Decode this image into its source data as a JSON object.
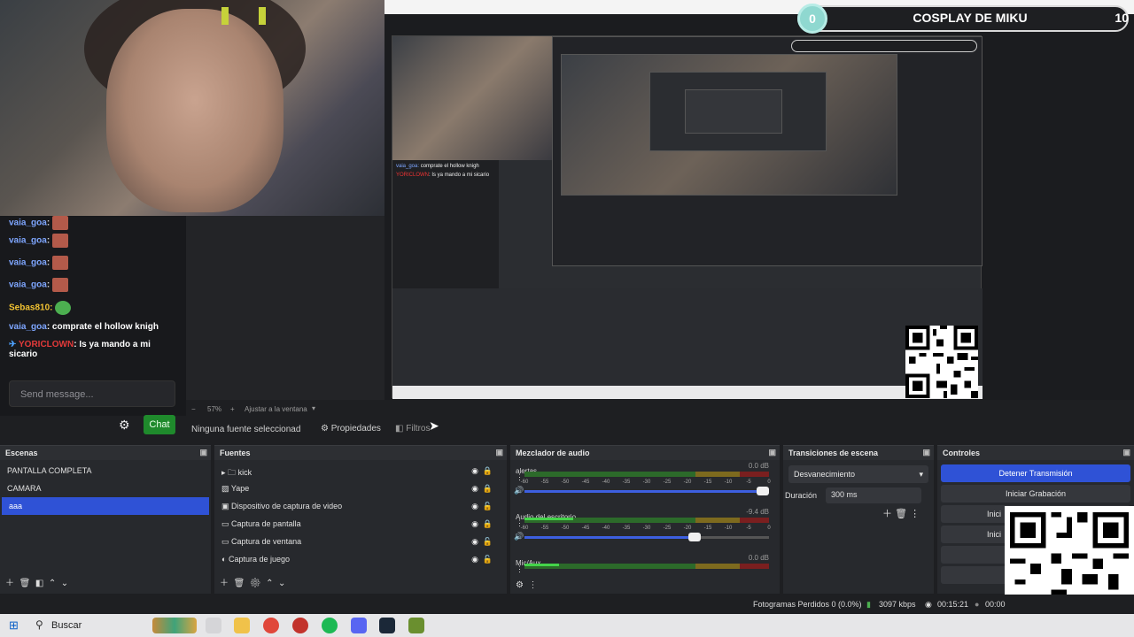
{
  "overlay": {
    "goal_current": "0",
    "goal_title": "COSPLAY DE MIKU",
    "goal_target": "10"
  },
  "chat": {
    "messages": [
      {
        "user": "vaia_goa",
        "text": ""
      },
      {
        "user": "vaia_goa",
        "text": ""
      },
      {
        "user": "vaia_goa",
        "text": ""
      },
      {
        "user": "vaia_goa",
        "text": ""
      },
      {
        "user": "Sebas810:",
        "text": ""
      },
      {
        "user": "vaia_goa",
        "text": ": comprate el hollow knigh"
      },
      {
        "user": "YORICLOWN",
        "text": ": Is ya mando a mi sicario"
      }
    ],
    "send_placeholder": "Send message...",
    "chat_button": "Chat"
  },
  "preview_bar": {
    "zoom": "57%",
    "fit": "Ajustar a la ventana"
  },
  "source_toolbar": {
    "no_source": "Ninguna fuente seleccionad",
    "properties": "Propiedades",
    "filters": "Filtros"
  },
  "scenes": {
    "title": "Escenas",
    "items": [
      "PANTALLA COMPLETA",
      "CAMARA",
      "aaa"
    ]
  },
  "sources": {
    "title": "Fuentes",
    "items": [
      "kick",
      "Yape",
      "Dispositivo de captura de video",
      "Captura de pantalla",
      "Captura de ventana",
      "Captura de juego"
    ]
  },
  "mixer": {
    "title": "Mezclador de audio",
    "channels": [
      {
        "name": "alertas",
        "db": "0.0 dB",
        "level": 0.0
      },
      {
        "name": "Audio del escritorio",
        "db": "-9.4 dB",
        "level": 0.2
      },
      {
        "name": "Mic/Aux",
        "db": "0.0 dB",
        "level": 0.14
      }
    ],
    "ticks": [
      "-60",
      "-55",
      "-50",
      "-45",
      "-40",
      "-35",
      "-30",
      "-25",
      "-20",
      "-15",
      "-10",
      "-5",
      "0"
    ]
  },
  "transitions": {
    "title": "Transiciones de escena",
    "selected": "Desvanecimiento",
    "duration_label": "Duración",
    "duration_value": "300 ms"
  },
  "controls": {
    "title": "Controles",
    "stop_stream": "Detener Transmisión",
    "start_record": "Iniciar Grabación",
    "btn3": "Inici",
    "btn4": "Inici"
  },
  "status": {
    "dropped": "Fotogramas Perdidos 0 (0.0%)",
    "bitrate": "3097 kbps",
    "time": "00:15:21",
    "rec": "00:00"
  },
  "taskbar": {
    "search": "Buscar"
  },
  "colors": {
    "accent": "#2f52d6",
    "chat_green": "#1f8a2c",
    "miku": "#8fd8d0"
  }
}
